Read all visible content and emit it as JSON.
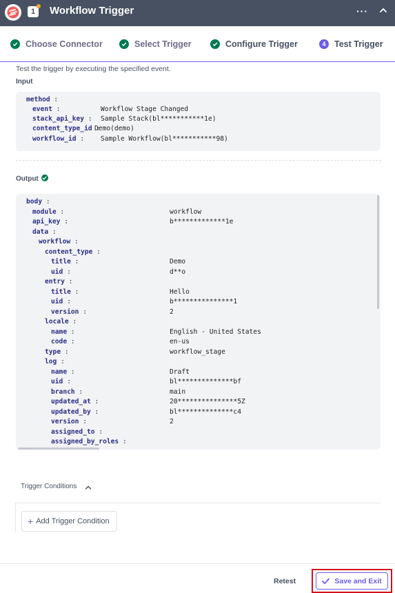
{
  "header": {
    "badge": "1",
    "title": "Workflow Trigger",
    "more": "···"
  },
  "steps": [
    {
      "label": "Choose Connector",
      "state": "done"
    },
    {
      "label": "Select Trigger",
      "state": "done"
    },
    {
      "label": "Configure Trigger",
      "state": "done"
    },
    {
      "label": "Test Trigger",
      "state": "active",
      "number": "4"
    }
  ],
  "description": "Test the trigger by executing the specified event.",
  "input": {
    "label": "Input",
    "root": "method",
    "fields": [
      {
        "key": "event",
        "value": "Workflow Stage Changed"
      },
      {
        "key": "stack_api_key",
        "value": "Sample Stack(bl***********1e)"
      },
      {
        "key": "content_type_id",
        "value": "Demo(demo)"
      },
      {
        "key": "workflow_id",
        "value": "Sample Workflow(bl***********98)"
      }
    ]
  },
  "output": {
    "label": "Output",
    "lines": [
      {
        "key": "body",
        "value": ""
      },
      {
        "key": "module",
        "value": "workflow"
      },
      {
        "key": "api_key",
        "value": "b*************1e"
      },
      {
        "key": "data",
        "value": ""
      },
      {
        "key": "workflow",
        "value": ""
      },
      {
        "key": "content_type",
        "value": ""
      },
      {
        "key": "title",
        "value": "Demo"
      },
      {
        "key": "uid",
        "value": "d**o"
      },
      {
        "key": "entry",
        "value": ""
      },
      {
        "key": "title",
        "value": "Hello"
      },
      {
        "key": "uid",
        "value": "b***************1"
      },
      {
        "key": "version",
        "value": "2"
      },
      {
        "key": "locale",
        "value": ""
      },
      {
        "key": "name",
        "value": "English - United States"
      },
      {
        "key": "code",
        "value": "en-us"
      },
      {
        "key": "type",
        "value": "workflow_stage"
      },
      {
        "key": "log",
        "value": ""
      },
      {
        "key": "name",
        "value": "Draft"
      },
      {
        "key": "uid",
        "value": "bl**************bf"
      },
      {
        "key": "branch",
        "value": "main"
      },
      {
        "key": "updated_at",
        "value": "20***************5Z"
      },
      {
        "key": "updated_by",
        "value": "bl**************c4"
      },
      {
        "key": "version",
        "value": "2"
      },
      {
        "key": "assigned_to",
        "value": ""
      },
      {
        "key": "assigned_by_roles",
        "value": ""
      }
    ]
  },
  "trigger_conditions": {
    "label": "Trigger Conditions",
    "add_label": "Add Trigger Condition"
  },
  "footer": {
    "retest": "Retest",
    "save": "Save and Exit"
  },
  "colors": {
    "header": "#475161",
    "accent": "#6c5ce7",
    "success": "#007a52",
    "highlight": "#d2101e"
  }
}
